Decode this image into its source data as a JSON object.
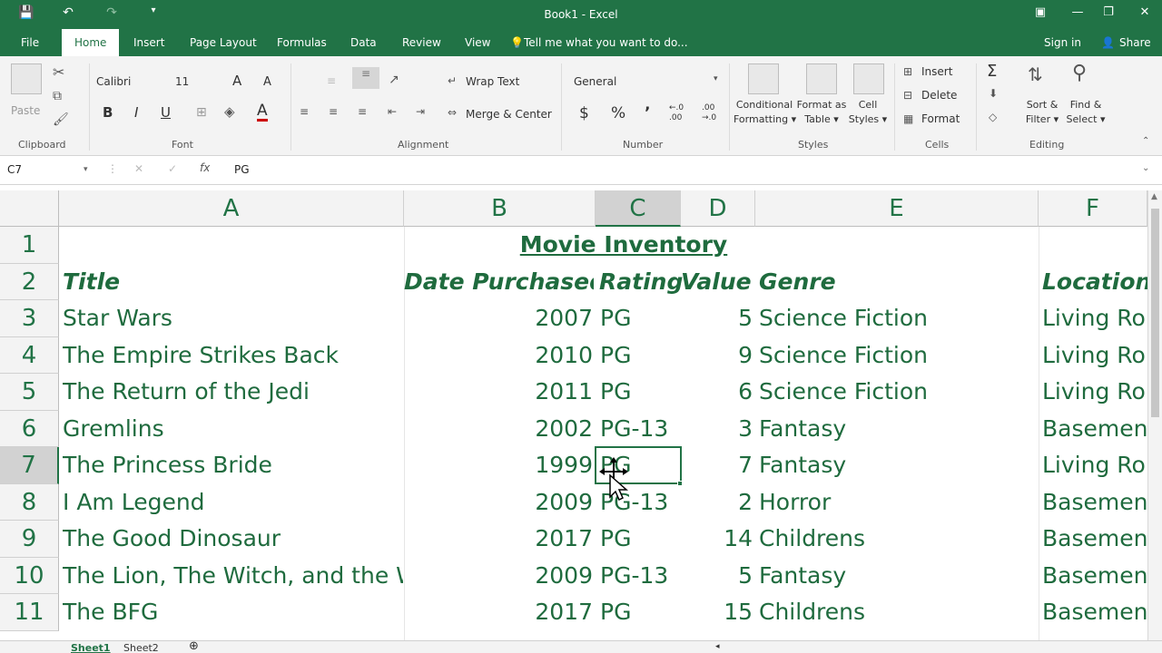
{
  "window": {
    "title": "Book1 - Excel"
  },
  "quick_access": {
    "save": "💾",
    "undo": "↶",
    "redo": "↷",
    "more": "▾"
  },
  "tabs": [
    "File",
    "Home",
    "Insert",
    "Page Layout",
    "Formulas",
    "Data",
    "Review",
    "View"
  ],
  "tell_me": "Tell me what you want to do...",
  "sign_in": "Sign in",
  "share": "Share",
  "ribbon": {
    "clipboard": {
      "paste": "Paste",
      "group": "Clipboard"
    },
    "font": {
      "name": "Calibri",
      "size": "11",
      "bold": "B",
      "italic": "I",
      "underline": "U",
      "grow": "A",
      "shrink": "A",
      "color": "A",
      "group": "Font"
    },
    "alignment": {
      "wrap": "Wrap Text",
      "merge": "Merge & Center",
      "group": "Alignment"
    },
    "number": {
      "format": "General",
      "currency": "$",
      "percent": "%",
      "comma": "’",
      "inc": "←.0 .00",
      "dec": ".00 →.0",
      "group": "Number"
    },
    "styles": {
      "conditional": [
        "Conditional",
        "Formatting ▾"
      ],
      "format_table": [
        "Format as",
        "Table ▾"
      ],
      "cell_styles": [
        "Cell",
        "Styles ▾"
      ],
      "group": "Styles"
    },
    "cells": {
      "insert": "Insert",
      "delete": "Delete",
      "format": "Format",
      "group": "Cells"
    },
    "editing": {
      "sum": "Σ",
      "sort": [
        "Sort &",
        "Filter ▾"
      ],
      "find": [
        "Find &",
        "Select ▾"
      ],
      "group": "Editing"
    }
  },
  "formula_bar": {
    "name_box": "C7",
    "fx": "fx",
    "value": "PG"
  },
  "columns": [
    "A",
    "B",
    "C",
    "D",
    "E",
    "F"
  ],
  "rows": [
    "1",
    "2",
    "3",
    "4",
    "5",
    "6",
    "7",
    "8",
    "9",
    "10",
    "11"
  ],
  "sheet": {
    "title": "Movie Inventory",
    "headers": {
      "title": "Title",
      "date": "Date Purchased",
      "rating": "Rating",
      "value": "Value",
      "genre": "Genre",
      "location": "Location"
    },
    "data": [
      {
        "title": "Star Wars",
        "date": "2007",
        "rating": "PG",
        "value": "5",
        "genre": "Science Fiction",
        "location": "Living Ro"
      },
      {
        "title": "The Empire Strikes Back",
        "date": "2010",
        "rating": "PG",
        "value": "9",
        "genre": "Science Fiction",
        "location": "Living Ro"
      },
      {
        "title": "The Return of the Jedi",
        "date": "2011",
        "rating": "PG",
        "value": "6",
        "genre": "Science Fiction",
        "location": "Living Ro"
      },
      {
        "title": "Gremlins",
        "date": "2002",
        "rating": "PG-13",
        "value": "3",
        "genre": "Fantasy",
        "location": "Basemen"
      },
      {
        "title": "The Princess Bride",
        "date": "1999",
        "rating": "PG",
        "value": "7",
        "genre": "Fantasy",
        "location": "Living Ro"
      },
      {
        "title": "I Am Legend",
        "date": "2009",
        "rating": "PG-13",
        "value": "2",
        "genre": "Horror",
        "location": "Basemen"
      },
      {
        "title": "The Good Dinosaur",
        "date": "2017",
        "rating": "PG",
        "value": "14",
        "genre": "Childrens",
        "location": "Basemen"
      },
      {
        "title": "The Lion, The Witch, and the W",
        "date": "2009",
        "rating": "PG-13",
        "value": "5",
        "genre": "Fantasy",
        "location": "Basemen"
      },
      {
        "title": "The BFG",
        "date": "2017",
        "rating": "PG",
        "value": "15",
        "genre": "Childrens",
        "location": "Basemen"
      }
    ]
  },
  "sheet_tabs": [
    "Sheet1",
    "Sheet2"
  ],
  "add_sheet": "⊕"
}
